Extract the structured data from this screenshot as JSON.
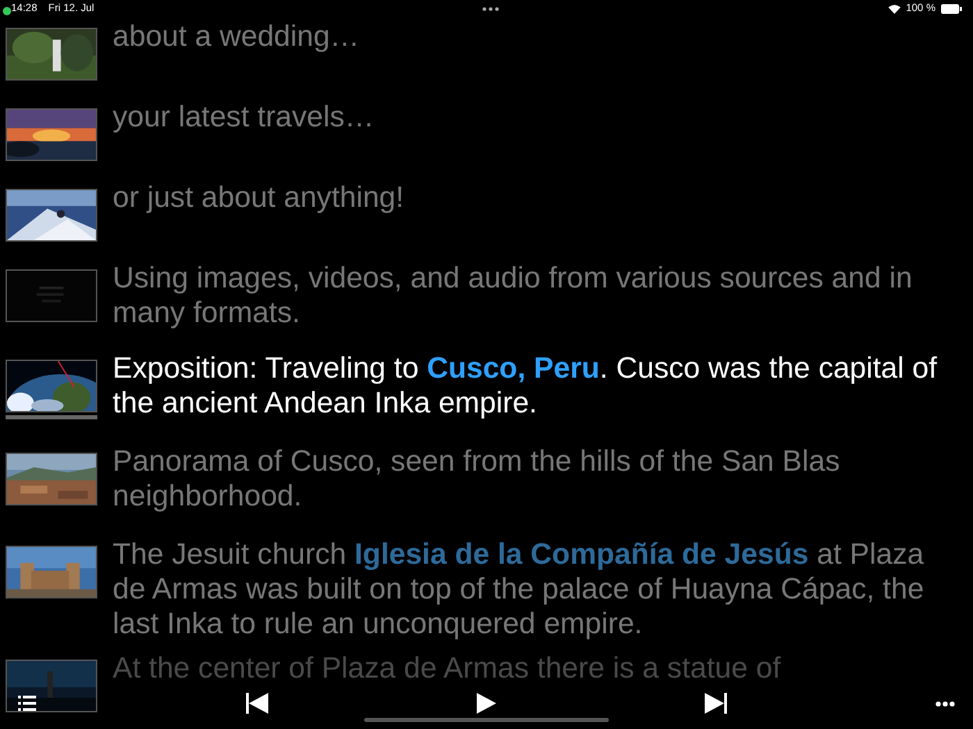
{
  "status_bar": {
    "time": "14:28",
    "date": "Fri 12. Jul",
    "battery": "100 %"
  },
  "items": [
    {
      "text": "about a wedding…",
      "selected": false
    },
    {
      "text": "your latest travels…",
      "selected": false
    },
    {
      "text": "or just about anything!",
      "selected": false
    },
    {
      "text": "Using images, videos, and audio from various sources and in many formats.",
      "selected": false
    },
    {
      "text": "Exposition: Traveling to **Cusco, Peru**. Cusco was the capital of the ancient Andean Inka empire.",
      "selected": true,
      "level": 1
    },
    {
      "text": "Panorama of Cusco, seen from the hills of the San Blas neighborhood.",
      "selected": false
    },
    {
      "text": "The Jesuit church **Iglesia de la Compañía de Jesús** at Plaza de Armas was built on top of the palace of Huayna Cápac, the last Inka to rule an unconquered empire.",
      "selected": false
    },
    {
      "text": "At the center of Plaza de Armas there is a statue of",
      "selected": false
    }
  ]
}
